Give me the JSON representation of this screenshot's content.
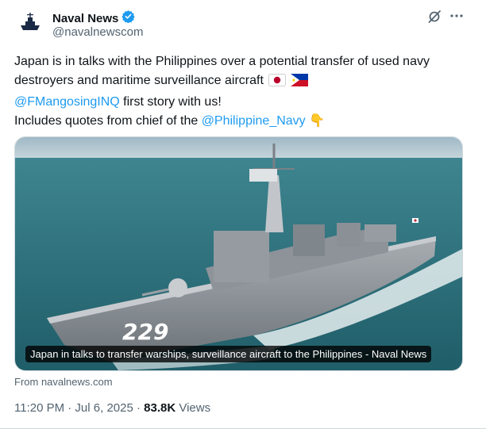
{
  "author": {
    "name": "Naval News",
    "handle": "@navalnewscom"
  },
  "post": {
    "line1": "Japan is in talks with the Philippines over a potential transfer of used navy destroyers and maritime surveillance aircraft",
    "mention1": "@FMangosingINQ",
    "line2_rest": " first story with us!",
    "line3_prefix": "Includes quotes from chief of the ",
    "mention2": "@Philippine_Navy",
    "emoji_down": "👇"
  },
  "media": {
    "caption": "Japan in talks to transfer warships, surveillance aircraft to the Philippines - Naval News",
    "hull_number": "229",
    "source": "From navalnews.com"
  },
  "meta": {
    "time": "11:20 PM · Jul 6, 2025 · ",
    "views_count": "83.8K",
    "views_label": " Views"
  },
  "colors": {
    "link": "#1d9bf0",
    "verified": "#1d9bf0",
    "sea": "#2c6f7a"
  },
  "icons": [
    "navy-ship-avatar-icon",
    "verified-badge-icon",
    "grok-icon",
    "more-icon",
    "japan-flag-icon",
    "philippines-flag-icon",
    "pointing-down-emoji"
  ]
}
